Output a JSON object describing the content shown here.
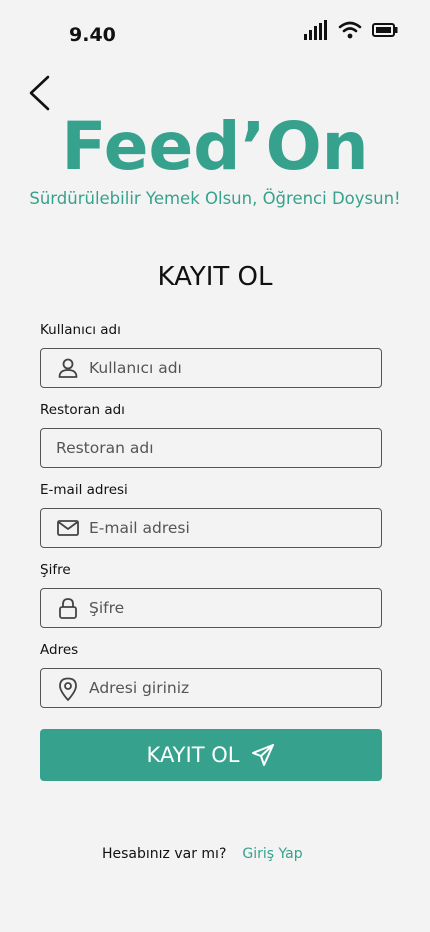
{
  "status_bar": {
    "time": "9.40"
  },
  "brand": {
    "logo_text": "Feed’On",
    "slogan": "Sürdürülebilir Yemek Olsun, Öğrenci Doysun!",
    "accent_color": "#36a28d"
  },
  "form": {
    "title": "KAYIT OL",
    "fields": [
      {
        "label": "Kullanıcı adı",
        "placeholder": "Kullanıcı adı",
        "icon": "user-icon"
      },
      {
        "label": "Restoran adı",
        "placeholder": "Restoran adı",
        "icon": ""
      },
      {
        "label": "E-mail adresi",
        "placeholder": "E-mail adresi",
        "icon": "mail-icon"
      },
      {
        "label": "Şifre",
        "placeholder": "Şifre",
        "icon": "lock-icon"
      },
      {
        "label": "Adres",
        "placeholder": "Adresi giriniz",
        "icon": "location-pin-icon"
      }
    ],
    "submit_label": "KAYIT OL",
    "submit_icon": "send-icon"
  },
  "footer": {
    "question": "Hesabınız var mı?",
    "login_link": "Giriş Yap"
  }
}
